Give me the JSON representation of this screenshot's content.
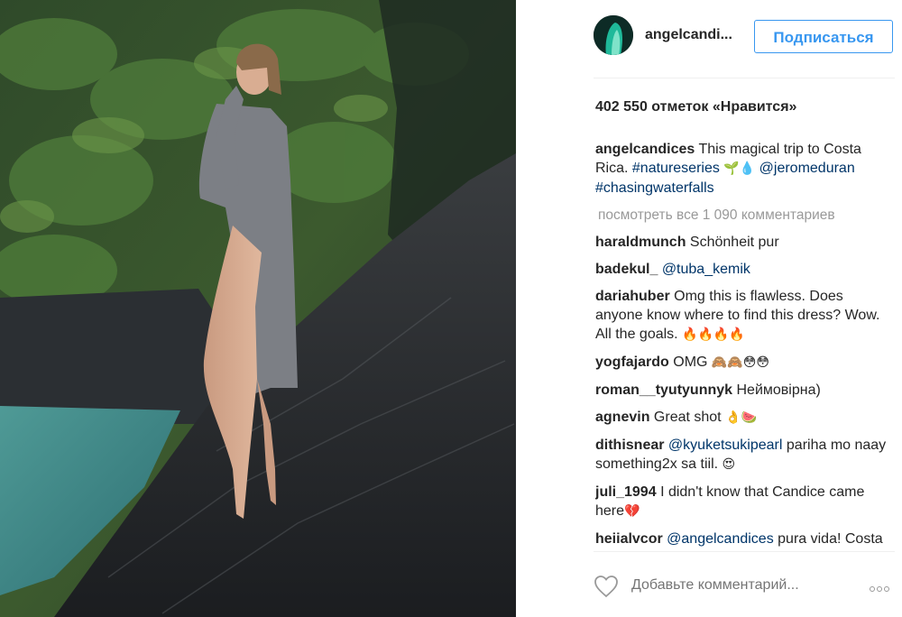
{
  "header": {
    "username": "angelcandi...",
    "follow_label": "Подписаться"
  },
  "likes_text": "402 550 отметок «Нравится»",
  "caption": {
    "username": "angelcandices",
    "text": "This magical trip to Costa Rica.",
    "hashtag1": "#natureseries",
    "emoji": "🌱💧",
    "mention": "@jeromeduran",
    "hashtag2": "#chasingwaterfalls"
  },
  "view_all_label": "посмотреть все 1 090 комментариев",
  "comments": [
    {
      "user": "haraldmunch",
      "text": "Schönheit pur",
      "mention": "",
      "emoji": ""
    },
    {
      "user": "badekul_",
      "text": "",
      "mention": "@tuba_kemik",
      "emoji": ""
    },
    {
      "user": "dariahuber",
      "text": "Omg this is flawless. Does anyone know where to find this dress? Wow. All the goals.",
      "mention": "",
      "emoji": "🔥🔥🔥🔥"
    },
    {
      "user": "yogfajardo",
      "text": "OMG",
      "mention": "",
      "emoji": "🙈🙈😳😳"
    },
    {
      "user": "roman__tyutyunnyk",
      "text": "Неймовірна)",
      "mention": "",
      "emoji": ""
    },
    {
      "user": "agnevin",
      "text": "Great shot",
      "mention": "",
      "emoji": "👌🍉"
    },
    {
      "user": "dithisnear",
      "text": "pariha mo naay something2x sa tiil.",
      "mention": "@kyuketsukipearl",
      "emoji": "😍"
    },
    {
      "user": "juli_1994",
      "text": "I didn't know that Candice came here",
      "mention": "",
      "emoji": "💔"
    },
    {
      "user": "heiialvcor",
      "text": "pura vida! Costa rica",
      "mention": "@angelcandices",
      "emoji": "😍🌋🏞"
    }
  ],
  "add_comment_placeholder": "Добавьте комментарий...",
  "icons": {
    "like": "heart-icon",
    "more": "more-options-icon"
  },
  "colors": {
    "accent": "#3897f0",
    "link": "#003569",
    "muted": "#999999"
  }
}
